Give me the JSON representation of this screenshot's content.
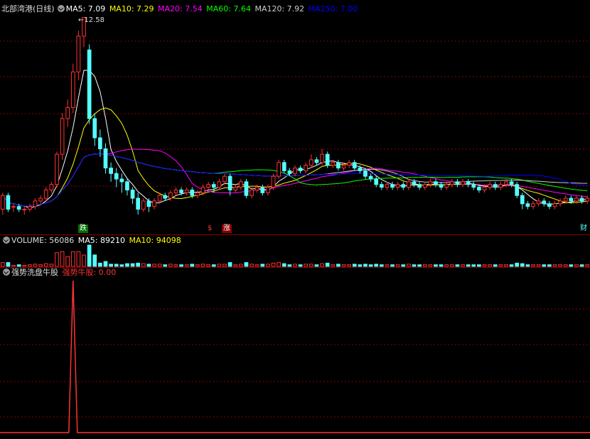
{
  "main": {
    "stock_name": "北部湾港(日线)",
    "ma_labels": [
      {
        "text": "MA5: 7.09",
        "color": "#ffffff"
      },
      {
        "text": "MA10: 7.29",
        "color": "#ffff00"
      },
      {
        "text": "MA20: 7.54",
        "color": "#ff00ff"
      },
      {
        "text": "MA60: 7.64",
        "color": "#00ff00"
      },
      {
        "text": "MA120: 7.92",
        "color": "#cccccc"
      },
      {
        "text": "MA250: 7.00",
        "color": "#0000ff"
      }
    ],
    "high_marker": "12.58",
    "signals": {
      "die": "跌",
      "s": "$",
      "zhang": "涨",
      "cai": "财"
    }
  },
  "volume": {
    "label": "VOLUME: 56086",
    "ma5": "MA5: 89210",
    "ma10": "MA10: 94098"
  },
  "indicator": {
    "name": "强势洗盘牛股",
    "value_label": "强势牛股: 0.00"
  },
  "colors": {
    "up": "#ff3232",
    "down": "#54ffff",
    "ma5": "#ffffff",
    "ma10": "#ffff00",
    "ma20": "#ff00ff",
    "ma60": "#00ff00",
    "ma120": "#cccccc",
    "ma250": "#0000ff",
    "grid": "#8b0000"
  },
  "chart_data": {
    "type": "candlestick",
    "note_high": 12.58,
    "candles": [
      [
        5.6,
        6.1,
        5.4,
        6.2
      ],
      [
        6.1,
        5.6,
        5.5,
        6.2
      ],
      [
        5.7,
        5.7,
        5.5,
        5.8
      ],
      [
        5.7,
        5.6,
        5.5,
        5.8
      ],
      [
        5.6,
        5.6,
        5.4,
        5.7
      ],
      [
        5.6,
        5.7,
        5.5,
        5.8
      ],
      [
        5.7,
        5.9,
        5.6,
        6.0
      ],
      [
        5.9,
        6.0,
        5.8,
        6.1
      ],
      [
        6.0,
        6.3,
        5.9,
        6.4
      ],
      [
        6.3,
        6.5,
        6.2,
        6.6
      ],
      [
        6.5,
        7.6,
        6.4,
        7.7
      ],
      [
        7.6,
        8.9,
        7.4,
        9.1
      ],
      [
        8.9,
        9.3,
        8.6,
        9.6
      ],
      [
        9.3,
        10.6,
        9.1,
        10.9
      ],
      [
        10.6,
        11.9,
        10.3,
        12.1
      ],
      [
        11.9,
        12.58,
        11.5,
        12.58
      ],
      [
        11.4,
        8.9,
        8.7,
        11.6
      ],
      [
        8.9,
        8.2,
        7.9,
        9.1
      ],
      [
        8.2,
        7.8,
        7.5,
        8.5
      ],
      [
        7.8,
        7.1,
        6.9,
        8.0
      ],
      [
        7.1,
        6.9,
        6.6,
        7.3
      ],
      [
        6.9,
        6.7,
        6.4,
        7.1
      ],
      [
        6.7,
        6.6,
        6.2,
        6.9
      ],
      [
        6.6,
        6.3,
        6.1,
        6.7
      ],
      [
        6.3,
        6.0,
        5.8,
        6.4
      ],
      [
        6.0,
        5.6,
        5.4,
        6.2
      ],
      [
        5.6,
        5.9,
        5.5,
        6.0
      ],
      [
        5.9,
        5.7,
        5.5,
        6.0
      ],
      [
        5.7,
        5.9,
        5.6,
        6.0
      ],
      [
        5.9,
        6.1,
        5.8,
        6.2
      ],
      [
        6.1,
        6.0,
        5.9,
        6.2
      ],
      [
        6.0,
        6.2,
        5.9,
        6.3
      ],
      [
        6.2,
        6.3,
        6.1,
        6.4
      ],
      [
        6.3,
        6.2,
        6.1,
        6.4
      ],
      [
        6.2,
        6.3,
        6.1,
        6.4
      ],
      [
        6.3,
        6.1,
        6.0,
        6.4
      ],
      [
        6.1,
        6.2,
        6.0,
        6.3
      ],
      [
        6.2,
        6.4,
        6.1,
        6.5
      ],
      [
        6.4,
        6.5,
        6.3,
        6.6
      ],
      [
        6.5,
        6.4,
        6.2,
        6.6
      ],
      [
        6.4,
        6.6,
        6.3,
        6.7
      ],
      [
        6.6,
        6.8,
        6.5,
        6.9
      ],
      [
        6.8,
        6.3,
        6.1,
        6.9
      ],
      [
        6.3,
        6.4,
        6.2,
        6.5
      ],
      [
        6.4,
        6.6,
        6.3,
        6.7
      ],
      [
        6.6,
        6.1,
        6.0,
        6.7
      ],
      [
        6.1,
        6.3,
        6.0,
        6.4
      ],
      [
        6.3,
        6.4,
        6.2,
        6.5
      ],
      [
        6.4,
        6.2,
        6.1,
        6.5
      ],
      [
        6.2,
        6.4,
        6.1,
        6.5
      ],
      [
        6.4,
        6.8,
        6.3,
        6.9
      ],
      [
        6.8,
        7.3,
        6.7,
        7.4
      ],
      [
        7.3,
        7.0,
        6.9,
        7.4
      ],
      [
        7.0,
        6.9,
        6.8,
        7.1
      ],
      [
        6.9,
        7.1,
        6.8,
        7.2
      ],
      [
        7.1,
        7.0,
        6.9,
        7.2
      ],
      [
        7.0,
        7.2,
        6.9,
        7.3
      ],
      [
        7.2,
        7.4,
        7.1,
        7.6
      ],
      [
        7.4,
        7.3,
        7.2,
        7.5
      ],
      [
        7.3,
        7.6,
        7.2,
        7.8
      ],
      [
        7.6,
        7.2,
        7.1,
        7.7
      ],
      [
        7.2,
        7.3,
        7.1,
        7.4
      ],
      [
        7.3,
        7.1,
        7.0,
        7.4
      ],
      [
        7.1,
        7.2,
        7.0,
        7.3
      ],
      [
        7.2,
        7.3,
        7.1,
        7.4
      ],
      [
        7.3,
        7.1,
        7.0,
        7.4
      ],
      [
        7.1,
        7.0,
        6.9,
        7.2
      ],
      [
        7.0,
        6.8,
        6.7,
        7.1
      ],
      [
        6.8,
        6.7,
        6.6,
        6.9
      ],
      [
        6.7,
        6.5,
        6.4,
        6.8
      ],
      [
        6.5,
        6.4,
        6.3,
        6.6
      ],
      [
        6.4,
        6.5,
        6.3,
        6.6
      ],
      [
        6.5,
        6.4,
        6.3,
        6.6
      ],
      [
        6.4,
        6.5,
        6.3,
        6.6
      ],
      [
        6.5,
        6.4,
        6.3,
        6.6
      ],
      [
        6.4,
        6.6,
        6.3,
        6.7
      ],
      [
        6.6,
        6.5,
        6.4,
        6.7
      ],
      [
        6.5,
        6.4,
        6.3,
        6.6
      ],
      [
        6.4,
        6.5,
        6.3,
        6.6
      ],
      [
        6.5,
        6.6,
        6.4,
        6.7
      ],
      [
        6.6,
        6.5,
        6.4,
        6.7
      ],
      [
        6.5,
        6.4,
        6.3,
        6.6
      ],
      [
        6.4,
        6.5,
        6.3,
        6.6
      ],
      [
        6.5,
        6.6,
        6.4,
        6.7
      ],
      [
        6.6,
        6.5,
        6.4,
        6.7
      ],
      [
        6.5,
        6.6,
        6.4,
        6.7
      ],
      [
        6.6,
        6.5,
        6.4,
        6.7
      ],
      [
        6.5,
        6.4,
        6.3,
        6.6
      ],
      [
        6.4,
        6.3,
        6.2,
        6.5
      ],
      [
        6.3,
        6.4,
        6.2,
        6.5
      ],
      [
        6.4,
        6.5,
        6.3,
        6.6
      ],
      [
        6.5,
        6.4,
        6.3,
        6.6
      ],
      [
        6.4,
        6.5,
        6.3,
        6.6
      ],
      [
        6.5,
        6.6,
        6.4,
        6.7
      ],
      [
        6.6,
        6.5,
        6.4,
        6.7
      ],
      [
        6.5,
        6.1,
        6.0,
        6.6
      ],
      [
        6.1,
        5.8,
        5.6,
        6.2
      ],
      [
        5.8,
        5.7,
        5.6,
        5.9
      ],
      [
        5.7,
        5.8,
        5.6,
        5.9
      ],
      [
        5.8,
        5.9,
        5.7,
        6.0
      ],
      [
        5.9,
        5.8,
        5.7,
        6.0
      ],
      [
        5.8,
        5.7,
        5.6,
        5.9
      ],
      [
        5.7,
        5.8,
        5.6,
        5.9
      ],
      [
        5.8,
        5.9,
        5.7,
        6.0
      ],
      [
        5.9,
        6.0,
        5.8,
        6.1
      ],
      [
        6.0,
        5.9,
        5.8,
        6.1
      ],
      [
        5.9,
        6.0,
        5.8,
        6.1
      ],
      [
        6.0,
        5.9,
        5.8,
        6.1
      ],
      [
        5.9,
        6.0,
        5.8,
        6.1
      ]
    ],
    "indicator_spike": {
      "index": 13,
      "value": 1
    }
  }
}
